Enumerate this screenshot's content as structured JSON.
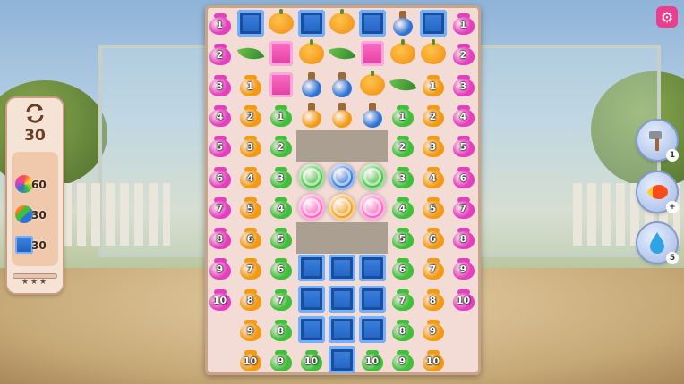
{
  "hud": {
    "moves_icon": "swap-arrows-icon",
    "moves_left": "30",
    "goals": [
      {
        "name": "rainbow-orb-goal-icon",
        "count": "60"
      },
      {
        "name": "striped-ball-goal-icon",
        "count": "30"
      },
      {
        "name": "blue-crate-goal-icon",
        "count": "30"
      }
    ],
    "progress": 0,
    "stars_text": "★★★"
  },
  "settings_icon": "gear-icon",
  "boosters": [
    {
      "name": "hammer-booster",
      "icon": "hammer-icon",
      "count": "1"
    },
    {
      "name": "rocket-booster",
      "icon": "rocket-icon",
      "count": "+"
    },
    {
      "name": "water-drop-booster",
      "icon": "drop-icon",
      "count": "5"
    }
  ],
  "colors": {
    "magenta": "#e53fbf",
    "orange": "#f39a12",
    "green": "#3fbf3a",
    "blue": "#2d73d6",
    "pink": "#ff5fbf"
  },
  "board": {
    "rows": [
      [
        "m1",
        "crate",
        "pumpkin",
        "crate",
        "pumpkin",
        "crate",
        "potion-blue",
        "crate",
        "m1"
      ],
      [
        "m2",
        "leaf",
        "pinkcrate",
        "pumpkin",
        "leaf",
        "pinkcrate",
        "pumpkin",
        "pumpkin",
        "m2"
      ],
      [
        "m3",
        "o1",
        "pinkcrate",
        "potion-blue",
        "potion-blue",
        "pumpkin",
        "leaf",
        "o1",
        "m3"
      ],
      [
        "m4",
        "o2",
        "g1",
        "potion-orange",
        "potion-orange",
        "potion-blue",
        "g1",
        "o2",
        "m4"
      ],
      [
        "m5",
        "o3",
        "g2",
        "-",
        "-",
        "-",
        "g2",
        "o3",
        "m5"
      ],
      [
        "m6",
        "o4",
        "g3",
        "orb-green",
        "orb-blue",
        "orb-green",
        "g3",
        "o4",
        "m6"
      ],
      [
        "m7",
        "o5",
        "g4",
        "orb-pink",
        "orb-orange",
        "orb-pink",
        "g4",
        "o5",
        "m7"
      ],
      [
        "m8",
        "o6",
        "g5",
        "-",
        "-",
        "-",
        "g5",
        "o6",
        "m8"
      ],
      [
        "m9",
        "o7",
        "g6",
        "crate",
        "crate",
        "crate",
        "g6",
        "o7",
        "m9"
      ],
      [
        "m10",
        "o8",
        "g7",
        "crate",
        "crate",
        "crate",
        "g7",
        "o8",
        "m10"
      ],
      [
        "",
        "o9",
        "g8",
        "crate",
        "crate",
        "crate",
        "g8",
        "o9",
        ""
      ],
      [
        "",
        "o10",
        "g9",
        "g10",
        "crate",
        "g10",
        "g9",
        "o10",
        ""
      ]
    ]
  }
}
